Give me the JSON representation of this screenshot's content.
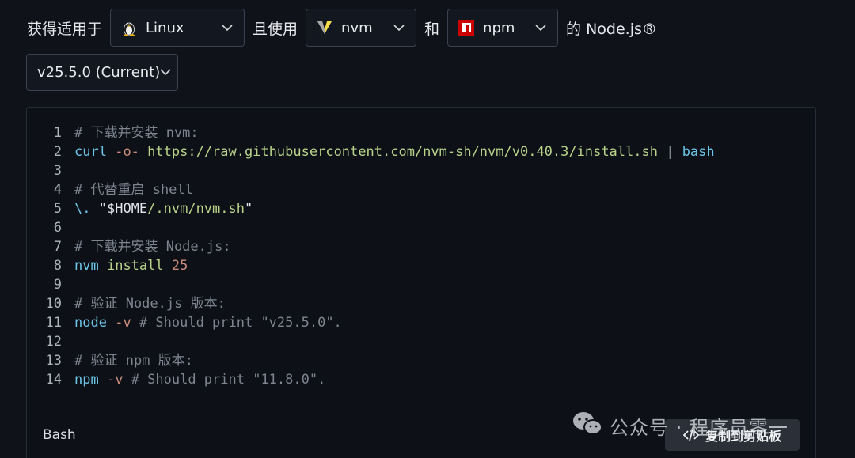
{
  "selector_row": {
    "prefix": "获得适用于",
    "os": {
      "label": "Linux",
      "icon": "linux-tux-icon"
    },
    "use_text": "且使用",
    "manager": {
      "label": "nvm",
      "icon": "nvm-icon"
    },
    "and_text": "和",
    "distribution": {
      "label": "npm",
      "icon": "npm-icon",
      "color": "#cb0000"
    },
    "suffix": "的 Node.js®"
  },
  "version": {
    "label": "v25.5.0 (Current)"
  },
  "code_block": {
    "lines": [
      {
        "n": "1",
        "tokens": [
          {
            "t": "# 下载并安装 nvm:",
            "c": "comment"
          }
        ]
      },
      {
        "n": "2",
        "tokens": [
          {
            "t": "curl",
            "c": "cmd"
          },
          {
            "t": " ",
            "c": "plain"
          },
          {
            "t": "-o-",
            "c": "flag"
          },
          {
            "t": " ",
            "c": "plain"
          },
          {
            "t": "https://raw.githubusercontent.com/nvm-sh/nvm/v0.40.3/install.sh",
            "c": "url"
          },
          {
            "t": " | ",
            "c": "pipe"
          },
          {
            "t": "bash",
            "c": "cmd"
          }
        ]
      },
      {
        "n": "3",
        "tokens": []
      },
      {
        "n": "4",
        "tokens": [
          {
            "t": "# 代替重启 shell",
            "c": "comment"
          }
        ]
      },
      {
        "n": "5",
        "tokens": [
          {
            "t": "\\.",
            "c": "cmd"
          },
          {
            "t": " \"",
            "c": "str"
          },
          {
            "t": "$HOME",
            "c": "str"
          },
          {
            "t": "/.nvm/nvm.sh",
            "c": "path"
          },
          {
            "t": "\"",
            "c": "str"
          }
        ]
      },
      {
        "n": "6",
        "tokens": []
      },
      {
        "n": "7",
        "tokens": [
          {
            "t": "# 下载并安装 Node.js:",
            "c": "comment"
          }
        ]
      },
      {
        "n": "8",
        "tokens": [
          {
            "t": "nvm",
            "c": "cmd"
          },
          {
            "t": " ",
            "c": "plain"
          },
          {
            "t": "install",
            "c": "url"
          },
          {
            "t": " ",
            "c": "plain"
          },
          {
            "t": "25",
            "c": "num"
          }
        ]
      },
      {
        "n": "9",
        "tokens": []
      },
      {
        "n": "10",
        "tokens": [
          {
            "t": "# 验证 Node.js 版本:",
            "c": "comment"
          }
        ]
      },
      {
        "n": "11",
        "tokens": [
          {
            "t": "node",
            "c": "cmd"
          },
          {
            "t": " ",
            "c": "plain"
          },
          {
            "t": "-v",
            "c": "flag"
          },
          {
            "t": " # Should print \"v25.5.0\".",
            "c": "comment"
          }
        ]
      },
      {
        "n": "12",
        "tokens": []
      },
      {
        "n": "13",
        "tokens": [
          {
            "t": "# 验证 npm 版本:",
            "c": "comment"
          }
        ]
      },
      {
        "n": "14",
        "tokens": [
          {
            "t": "npm",
            "c": "cmd"
          },
          {
            "t": " ",
            "c": "plain"
          },
          {
            "t": "-v",
            "c": "flag"
          },
          {
            "t": " # Should print \"11.8.0\".",
            "c": "comment"
          }
        ]
      }
    ]
  },
  "footer": {
    "language": "Bash",
    "copy_button": {
      "label": "复制到剪贴板",
      "icon": "code-brackets-icon"
    }
  },
  "watermark": {
    "text": "公众号 · 程序员零一",
    "icon": "wechat-icon"
  }
}
